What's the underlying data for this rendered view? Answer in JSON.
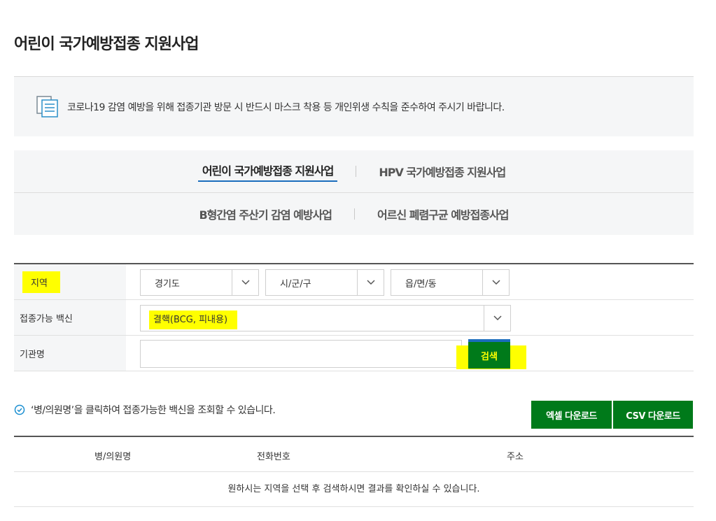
{
  "page": {
    "title": "어린이 국가예방접종 지원사업"
  },
  "notice": {
    "icon": "document-list-icon",
    "text": "코로나19 감염 예방을 위해 접종기관 방문 시 반드시 마스크 착용 등 개인위생 수칙을 준수하여 주시기 바랍니다."
  },
  "tabs": [
    {
      "label": "어린이 국가예방접종 지원사업",
      "active": true
    },
    {
      "label": "HPV 국가예방접종 지원사업",
      "active": false
    },
    {
      "label": "B형간염 주산기 감염 예방사업",
      "active": false
    },
    {
      "label": "어르신 폐렴구균 예방접종사업",
      "active": false
    }
  ],
  "form": {
    "region_label": "지역",
    "province": "경기도",
    "district": "시/군/구",
    "town": "읍/면/동",
    "vaccine_label": "접종가능 백신",
    "vaccine": "결핵(BCG, 피내용)",
    "org_label": "기관명",
    "org_value": "",
    "search_label": "검색"
  },
  "hint": {
    "text": "‘병/의원명’을 클릭하여 접종가능한 백신을 조회할 수 있습니다."
  },
  "downloads": {
    "excel": "엑셀 다운로드",
    "csv": "CSV 다운로드"
  },
  "table": {
    "headers": [
      "병/의원명",
      "전화번호",
      "주소"
    ],
    "empty_message": "원하시는 지역을 선택 후 검색하시면 결과를 확인하실 수 있습니다."
  },
  "colors": {
    "accent_green": "#007a1a",
    "tab_underline_blue": "#1b6dbd",
    "highlight_yellow": "#ffff00"
  }
}
